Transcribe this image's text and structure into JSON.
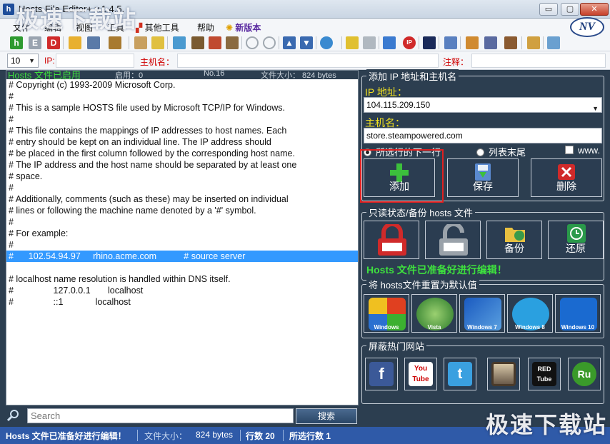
{
  "window": {
    "title": "Hosts File Editor+ v.1.4.5.",
    "watermark": "极速下载站",
    "minimize_glyph": "▭",
    "maximize_glyph": "▢",
    "close_glyph": "✕"
  },
  "menu": {
    "items": [
      "文件",
      "编辑",
      "视图",
      "工具"
    ],
    "other_tools": "其他工具",
    "help": "帮助",
    "new_version": "新版本"
  },
  "logo": "NV",
  "filter": {
    "count": "10",
    "ip_label": "IP:",
    "host_label": "主机名：",
    "note_label": "注释："
  },
  "editor": {
    "status": "Hosts 文件已启用",
    "enabled_label": "启用：0",
    "line_no": "No.16",
    "file_size": "文件大小：  824 bytes",
    "lines": [
      "# Copyright (c) 1993-2009 Microsoft Corp.",
      "#",
      "# This is a sample HOSTS file used by Microsoft TCP/IP for Windows.",
      "#",
      "# This file contains the mappings of IP addresses to host names. Each",
      "# entry should be kept on an individual line. The IP address should",
      "# be placed in the first column followed by the corresponding host name.",
      "# The IP address and the host name should be separated by at least one",
      "# space.",
      "#",
      "# Additionally, comments (such as these) may be inserted on individual",
      "# lines or following the machine name denoted by a '#' symbol.",
      "#",
      "# For example:",
      "#",
      "#      102.54.94.97     rhino.acme.com           # source server",
      "",
      "# localhost name resolution is handled within DNS itself.",
      "#                127.0.0.1       localhost",
      "#                ::1             localhost"
    ],
    "selected_line": 15
  },
  "search": {
    "placeholder": "Search",
    "button": "搜索"
  },
  "status_bar": {
    "message": "Hosts 文件已准备好进行编辑！",
    "size_label": "文件大小：",
    "size_value": "824 bytes",
    "rows": "行数 20",
    "selected_rows": "所选行数 1"
  },
  "add_panel": {
    "title": "添加 IP 地址和主机名",
    "ip_label": "IP 地址：",
    "ip_value": "104.115.209.150",
    "host_label": "主机名：",
    "host_value": "store.steampowered.com",
    "radio_selected": "所选行的下一行",
    "radio_end": "列表末尾",
    "check_www": "www.",
    "add": "添加",
    "save": "保存",
    "delete": "删除"
  },
  "backup_panel": {
    "title": "只读状态/备份 hosts 文件",
    "backup": "备份",
    "restore": "还原",
    "status": "Hosts 文件已准备好进行编辑！"
  },
  "reset_panel": {
    "title": "将 hosts文件重置为默认值",
    "os": [
      "Windows",
      "Vista",
      "Windows 7",
      "Windows 8",
      "Windows 10"
    ]
  },
  "block_panel": {
    "title": "屏蔽热门网站",
    "sites": [
      "f",
      "You Tube",
      "t",
      "",
      "RED Tube",
      "Ru"
    ]
  },
  "colors": {
    "background": "#2c3e50",
    "status_green": "#3ee03e",
    "label_yellow": "#f0e020",
    "selection": "#3399ff",
    "statusbar": "#2f5aa8"
  }
}
